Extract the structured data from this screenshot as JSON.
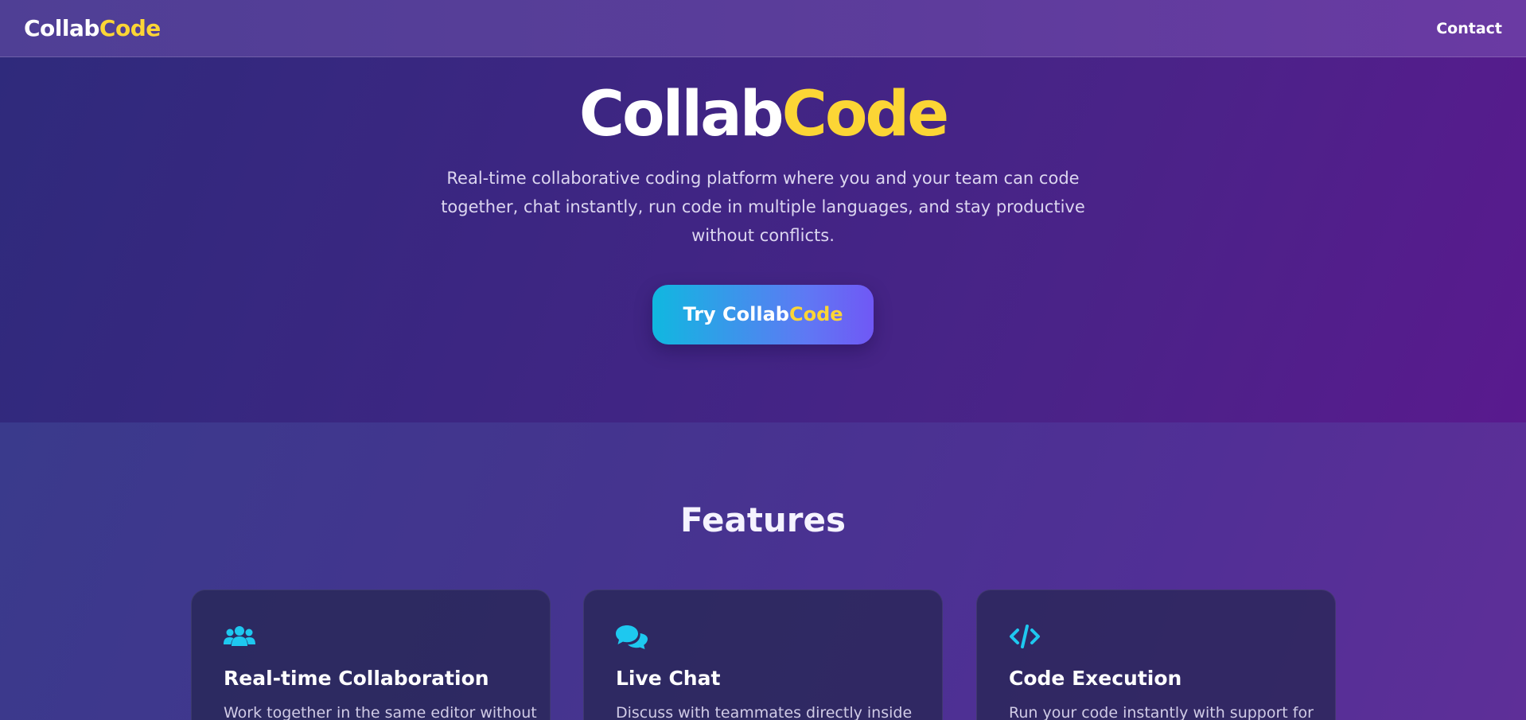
{
  "nav": {
    "logo_part1": "Collab",
    "logo_part2": "Code",
    "contact_label": "Contact"
  },
  "hero": {
    "title_part1": "Collab",
    "title_part2": "Code",
    "subtitle": "Real-time collaborative coding platform where you and your team can code together, chat instantly, run code in multiple languages, and stay productive without conflicts.",
    "cta_part1": "Try Collab",
    "cta_part2": "Code"
  },
  "features": {
    "heading": "Features",
    "cards": [
      {
        "icon": "users-icon",
        "title": "Real-time Collaboration",
        "description": "Work together in the same editor without"
      },
      {
        "icon": "chat-bubbles-icon",
        "title": "Live Chat",
        "description": "Discuss with teammates directly inside"
      },
      {
        "icon": "code-icon",
        "title": "Code Execution",
        "description": "Run your code instantly with support for"
      }
    ]
  },
  "colors": {
    "accent_yellow": "#fcd535",
    "icon_cyan": "#1ec8ef",
    "cta_start": "#10b8e0",
    "cta_end": "#7058f5"
  }
}
